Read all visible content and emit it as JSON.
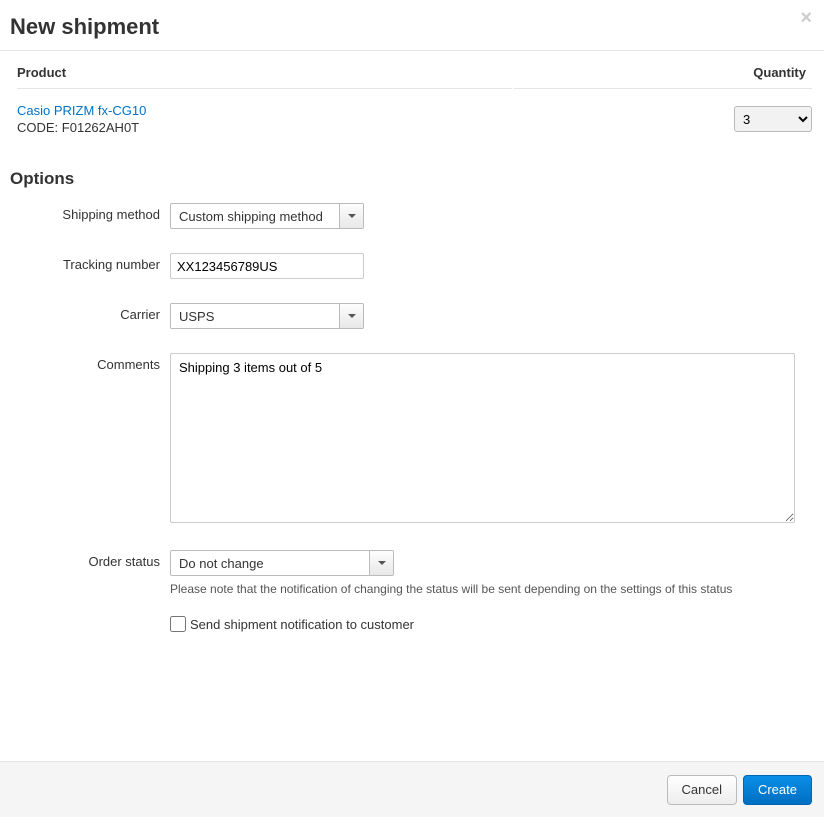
{
  "header": {
    "title": "New shipment"
  },
  "table": {
    "col_product": "Product",
    "col_quantity": "Quantity",
    "rows": [
      {
        "name": "Casio PRIZM fx-CG10",
        "code_prefix": "CODE:",
        "code": "F01262AH0T",
        "quantity": "3"
      }
    ]
  },
  "options": {
    "heading": "Options",
    "shipping_method": {
      "label": "Shipping method",
      "value": "Custom shipping method"
    },
    "tracking_number": {
      "label": "Tracking number",
      "value": "XX123456789US"
    },
    "carrier": {
      "label": "Carrier",
      "value": "USPS"
    },
    "comments": {
      "label": "Comments",
      "value": "Shipping 3 items out of 5"
    },
    "order_status": {
      "label": "Order status",
      "value": "Do not change",
      "help": "Please note that the notification of changing the status will be sent depending on the settings of this status"
    },
    "notify": {
      "label": "Send shipment notification to customer",
      "checked": false
    }
  },
  "footer": {
    "cancel": "Cancel",
    "create": "Create"
  }
}
